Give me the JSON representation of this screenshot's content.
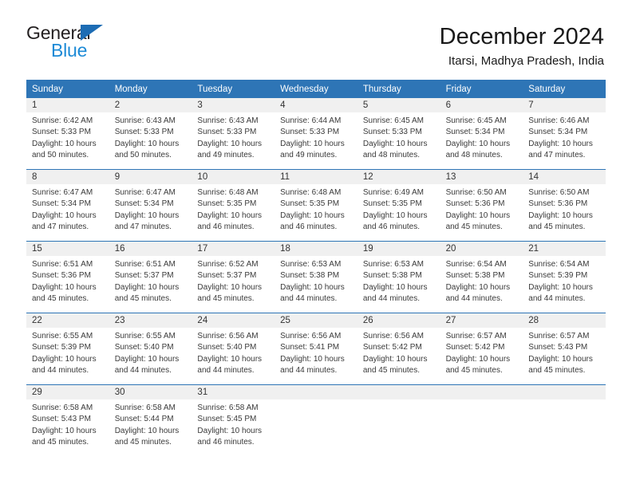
{
  "brand": {
    "name_part1": "General",
    "name_part2": "Blue",
    "triangle_color": "#1c6cb4",
    "blue_text_color": "#1c8ad6"
  },
  "header": {
    "title": "December 2024",
    "subtitle": "Itarsi, Madhya Pradesh, India"
  },
  "theme": {
    "header_blue": "#2e75b6",
    "daynum_band": "#f0f0f0",
    "cell_background": "#ffffff",
    "text": "#3a3a3a"
  },
  "calendar": {
    "weekdays": [
      "Sunday",
      "Monday",
      "Tuesday",
      "Wednesday",
      "Thursday",
      "Friday",
      "Saturday"
    ],
    "weeks": [
      [
        {
          "day": "1",
          "sunrise": "Sunrise: 6:42 AM",
          "sunset": "Sunset: 5:33 PM",
          "daylight": "Daylight: 10 hours and 50 minutes."
        },
        {
          "day": "2",
          "sunrise": "Sunrise: 6:43 AM",
          "sunset": "Sunset: 5:33 PM",
          "daylight": "Daylight: 10 hours and 50 minutes."
        },
        {
          "day": "3",
          "sunrise": "Sunrise: 6:43 AM",
          "sunset": "Sunset: 5:33 PM",
          "daylight": "Daylight: 10 hours and 49 minutes."
        },
        {
          "day": "4",
          "sunrise": "Sunrise: 6:44 AM",
          "sunset": "Sunset: 5:33 PM",
          "daylight": "Daylight: 10 hours and 49 minutes."
        },
        {
          "day": "5",
          "sunrise": "Sunrise: 6:45 AM",
          "sunset": "Sunset: 5:33 PM",
          "daylight": "Daylight: 10 hours and 48 minutes."
        },
        {
          "day": "6",
          "sunrise": "Sunrise: 6:45 AM",
          "sunset": "Sunset: 5:34 PM",
          "daylight": "Daylight: 10 hours and 48 minutes."
        },
        {
          "day": "7",
          "sunrise": "Sunrise: 6:46 AM",
          "sunset": "Sunset: 5:34 PM",
          "daylight": "Daylight: 10 hours and 47 minutes."
        }
      ],
      [
        {
          "day": "8",
          "sunrise": "Sunrise: 6:47 AM",
          "sunset": "Sunset: 5:34 PM",
          "daylight": "Daylight: 10 hours and 47 minutes."
        },
        {
          "day": "9",
          "sunrise": "Sunrise: 6:47 AM",
          "sunset": "Sunset: 5:34 PM",
          "daylight": "Daylight: 10 hours and 47 minutes."
        },
        {
          "day": "10",
          "sunrise": "Sunrise: 6:48 AM",
          "sunset": "Sunset: 5:35 PM",
          "daylight": "Daylight: 10 hours and 46 minutes."
        },
        {
          "day": "11",
          "sunrise": "Sunrise: 6:48 AM",
          "sunset": "Sunset: 5:35 PM",
          "daylight": "Daylight: 10 hours and 46 minutes."
        },
        {
          "day": "12",
          "sunrise": "Sunrise: 6:49 AM",
          "sunset": "Sunset: 5:35 PM",
          "daylight": "Daylight: 10 hours and 46 minutes."
        },
        {
          "day": "13",
          "sunrise": "Sunrise: 6:50 AM",
          "sunset": "Sunset: 5:36 PM",
          "daylight": "Daylight: 10 hours and 45 minutes."
        },
        {
          "day": "14",
          "sunrise": "Sunrise: 6:50 AM",
          "sunset": "Sunset: 5:36 PM",
          "daylight": "Daylight: 10 hours and 45 minutes."
        }
      ],
      [
        {
          "day": "15",
          "sunrise": "Sunrise: 6:51 AM",
          "sunset": "Sunset: 5:36 PM",
          "daylight": "Daylight: 10 hours and 45 minutes."
        },
        {
          "day": "16",
          "sunrise": "Sunrise: 6:51 AM",
          "sunset": "Sunset: 5:37 PM",
          "daylight": "Daylight: 10 hours and 45 minutes."
        },
        {
          "day": "17",
          "sunrise": "Sunrise: 6:52 AM",
          "sunset": "Sunset: 5:37 PM",
          "daylight": "Daylight: 10 hours and 45 minutes."
        },
        {
          "day": "18",
          "sunrise": "Sunrise: 6:53 AM",
          "sunset": "Sunset: 5:38 PM",
          "daylight": "Daylight: 10 hours and 44 minutes."
        },
        {
          "day": "19",
          "sunrise": "Sunrise: 6:53 AM",
          "sunset": "Sunset: 5:38 PM",
          "daylight": "Daylight: 10 hours and 44 minutes."
        },
        {
          "day": "20",
          "sunrise": "Sunrise: 6:54 AM",
          "sunset": "Sunset: 5:38 PM",
          "daylight": "Daylight: 10 hours and 44 minutes."
        },
        {
          "day": "21",
          "sunrise": "Sunrise: 6:54 AM",
          "sunset": "Sunset: 5:39 PM",
          "daylight": "Daylight: 10 hours and 44 minutes."
        }
      ],
      [
        {
          "day": "22",
          "sunrise": "Sunrise: 6:55 AM",
          "sunset": "Sunset: 5:39 PM",
          "daylight": "Daylight: 10 hours and 44 minutes."
        },
        {
          "day": "23",
          "sunrise": "Sunrise: 6:55 AM",
          "sunset": "Sunset: 5:40 PM",
          "daylight": "Daylight: 10 hours and 44 minutes."
        },
        {
          "day": "24",
          "sunrise": "Sunrise: 6:56 AM",
          "sunset": "Sunset: 5:40 PM",
          "daylight": "Daylight: 10 hours and 44 minutes."
        },
        {
          "day": "25",
          "sunrise": "Sunrise: 6:56 AM",
          "sunset": "Sunset: 5:41 PM",
          "daylight": "Daylight: 10 hours and 44 minutes."
        },
        {
          "day": "26",
          "sunrise": "Sunrise: 6:56 AM",
          "sunset": "Sunset: 5:42 PM",
          "daylight": "Daylight: 10 hours and 45 minutes."
        },
        {
          "day": "27",
          "sunrise": "Sunrise: 6:57 AM",
          "sunset": "Sunset: 5:42 PM",
          "daylight": "Daylight: 10 hours and 45 minutes."
        },
        {
          "day": "28",
          "sunrise": "Sunrise: 6:57 AM",
          "sunset": "Sunset: 5:43 PM",
          "daylight": "Daylight: 10 hours and 45 minutes."
        }
      ],
      [
        {
          "day": "29",
          "sunrise": "Sunrise: 6:58 AM",
          "sunset": "Sunset: 5:43 PM",
          "daylight": "Daylight: 10 hours and 45 minutes."
        },
        {
          "day": "30",
          "sunrise": "Sunrise: 6:58 AM",
          "sunset": "Sunset: 5:44 PM",
          "daylight": "Daylight: 10 hours and 45 minutes."
        },
        {
          "day": "31",
          "sunrise": "Sunrise: 6:58 AM",
          "sunset": "Sunset: 5:45 PM",
          "daylight": "Daylight: 10 hours and 46 minutes."
        },
        {
          "day": "",
          "sunrise": "",
          "sunset": "",
          "daylight": ""
        },
        {
          "day": "",
          "sunrise": "",
          "sunset": "",
          "daylight": ""
        },
        {
          "day": "",
          "sunrise": "",
          "sunset": "",
          "daylight": ""
        },
        {
          "day": "",
          "sunrise": "",
          "sunset": "",
          "daylight": ""
        }
      ]
    ]
  }
}
